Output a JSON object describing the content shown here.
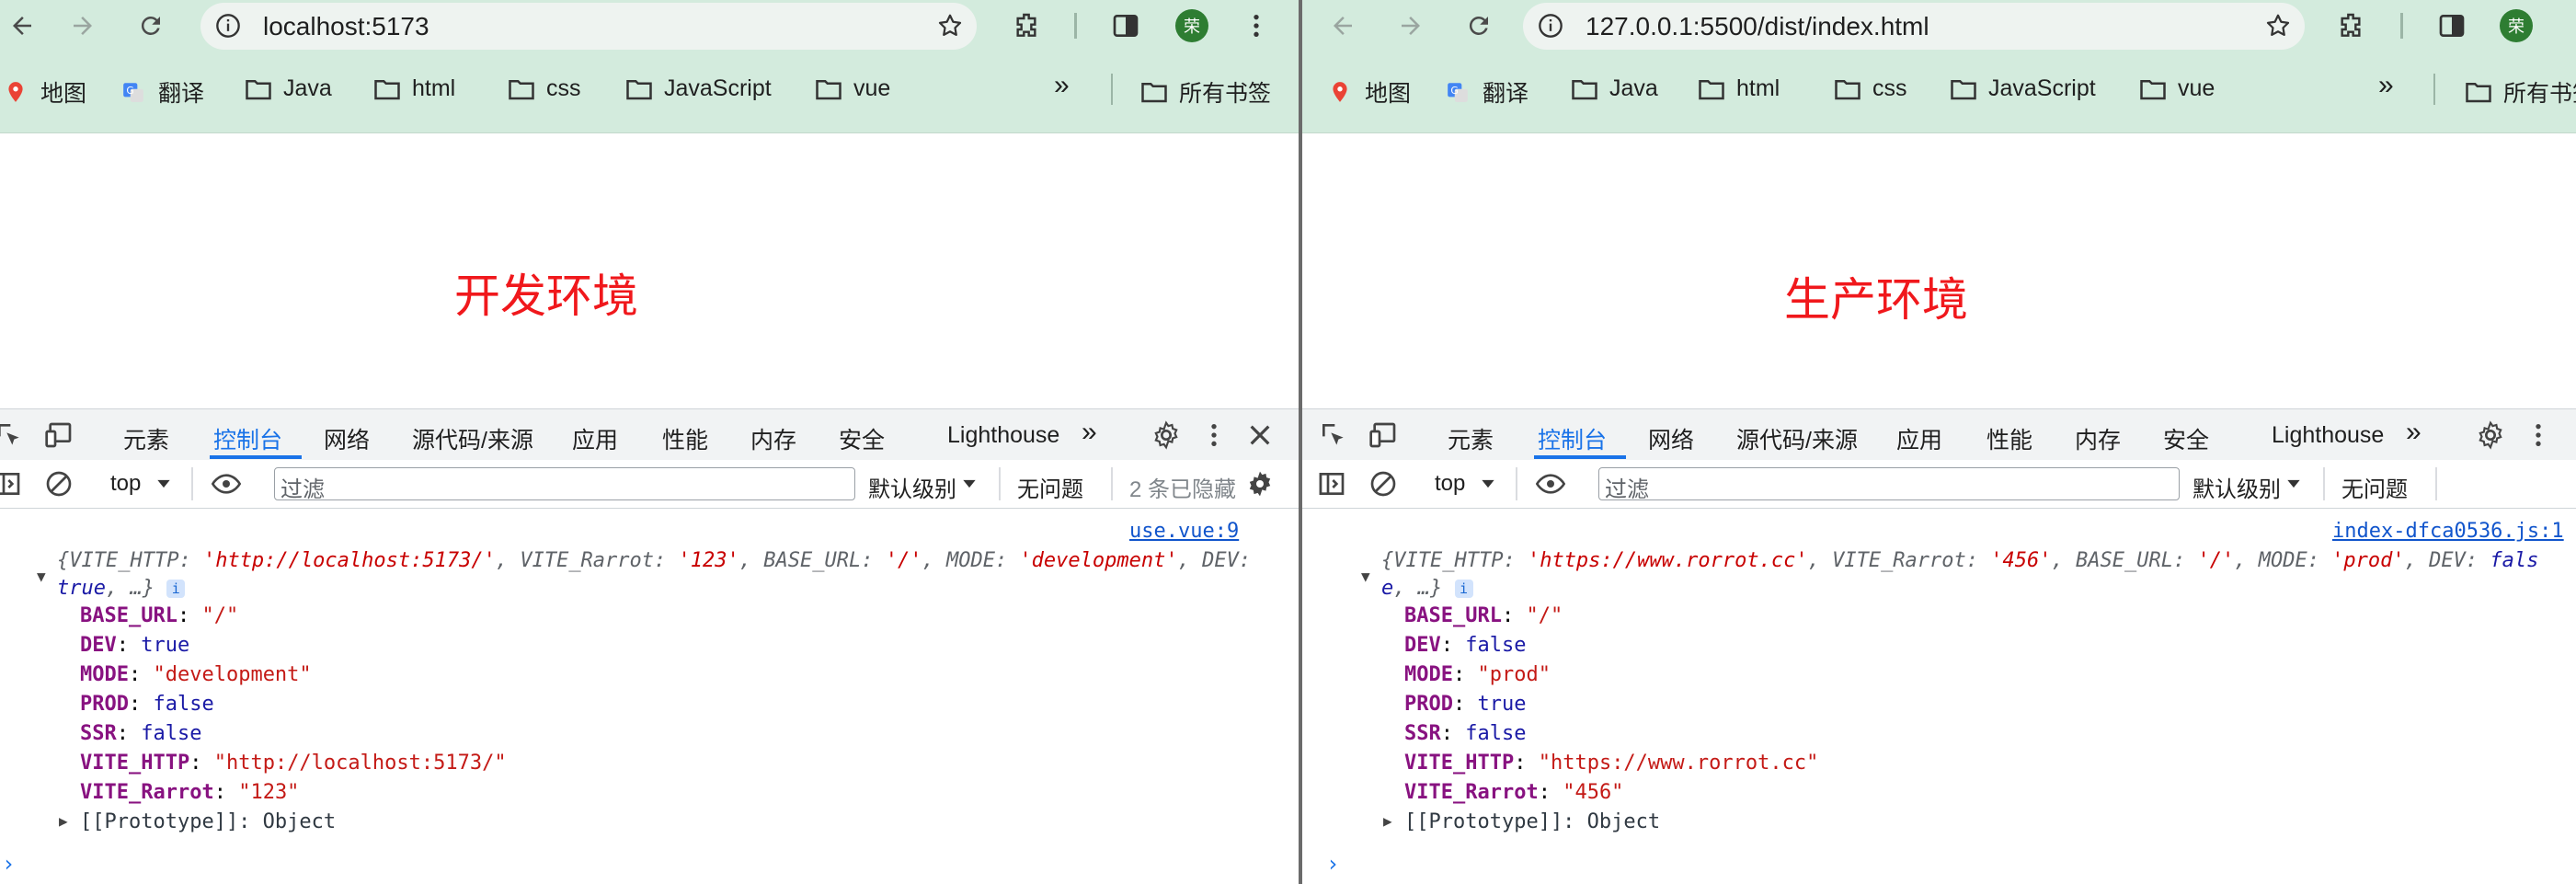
{
  "left": {
    "url": "localhost:5173",
    "heading": "开发环境",
    "source_link": "use.vue:9",
    "filter_hidden": "2 条已隐藏",
    "summary": {
      "VITE_HTTP": "'http://localhost:5173/'",
      "VITE_Rarrot": "'123'",
      "BASE_URL": "'/'",
      "MODE": "'development'",
      "DEV": "true"
    },
    "props": [
      {
        "key": "BASE_URL",
        "value": "\"/\"",
        "type": "s"
      },
      {
        "key": "DEV",
        "value": "true",
        "type": "b"
      },
      {
        "key": "MODE",
        "value": "\"development\"",
        "type": "s"
      },
      {
        "key": "PROD",
        "value": "false",
        "type": "b"
      },
      {
        "key": "SSR",
        "value": "false",
        "type": "b"
      },
      {
        "key": "VITE_HTTP",
        "value": "\"http://localhost:5173/\"",
        "type": "s"
      },
      {
        "key": "VITE_Rarrot",
        "value": "\"123\"",
        "type": "s"
      }
    ]
  },
  "right": {
    "url": "127.0.0.1:5500/dist/index.html",
    "heading": "生产环境",
    "source_link": "index-dfca0536.js:1",
    "summary": {
      "VITE_HTTP": "'https://www.rorrot.cc'",
      "VITE_Rarrot": "'456'",
      "BASE_URL": "'/'",
      "MODE": "'prod'",
      "DEV": "fals",
      "DEV_wrap": "e"
    },
    "props": [
      {
        "key": "BASE_URL",
        "value": "\"/\"",
        "type": "s"
      },
      {
        "key": "DEV",
        "value": "false",
        "type": "b"
      },
      {
        "key": "MODE",
        "value": "\"prod\"",
        "type": "s"
      },
      {
        "key": "PROD",
        "value": "true",
        "type": "b"
      },
      {
        "key": "SSR",
        "value": "false",
        "type": "b"
      },
      {
        "key": "VITE_HTTP",
        "value": "\"https://www.rorrot.cc\"",
        "type": "s"
      },
      {
        "key": "VITE_Rarrot",
        "value": "\"456\"",
        "type": "s"
      }
    ]
  },
  "common": {
    "avatar_text": "荣",
    "bookmarks": [
      "地图",
      "翻译",
      "Java",
      "html",
      "css",
      "JavaScript",
      "vue"
    ],
    "all_bookmarks": "所有书签",
    "more": "»",
    "devtools_tabs": [
      "元素",
      "控制台",
      "网络",
      "源代码/来源",
      "应用",
      "性能",
      "内存",
      "安全",
      "Lighthouse"
    ],
    "context": "top",
    "filter_placeholder": "过滤",
    "level": "默认级别",
    "no_issues": "无问题",
    "proto": "[[Prototype]]: Object",
    "ellipsis": "…}",
    "info_badge": "i",
    "prompt": "›"
  },
  "colors": {
    "toolbar_bg": "#d3ebdd",
    "heading": "#f0181c",
    "active_tab": "#1a73e8",
    "string": "#c41a16",
    "key": "#881280"
  }
}
